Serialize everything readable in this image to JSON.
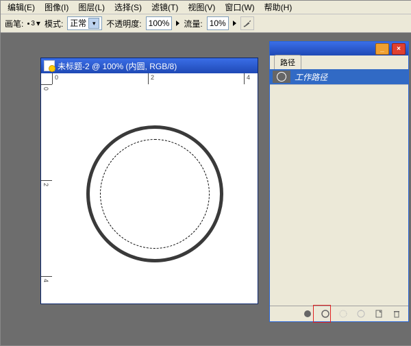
{
  "menu": {
    "edit": "编辑(E)",
    "image": "图像(I)",
    "layer": "图层(L)",
    "select": "选择(S)",
    "filter": "滤镜(T)",
    "view": "视图(V)",
    "window": "窗口(W)",
    "help": "帮助(H)"
  },
  "options": {
    "brush_label": "画笔:",
    "brush_size": "3",
    "mode_label": "模式:",
    "mode_value": "正常",
    "opacity_label": "不透明度:",
    "opacity_value": "100%",
    "flow_label": "流量:",
    "flow_value": "10%"
  },
  "document": {
    "title": "未标题-2 @ 100% (内圆, RGB/8)",
    "ruler_nums": [
      "0",
      "2",
      "4"
    ]
  },
  "panel": {
    "tab_label": "路径",
    "path_name": "工作路径"
  }
}
